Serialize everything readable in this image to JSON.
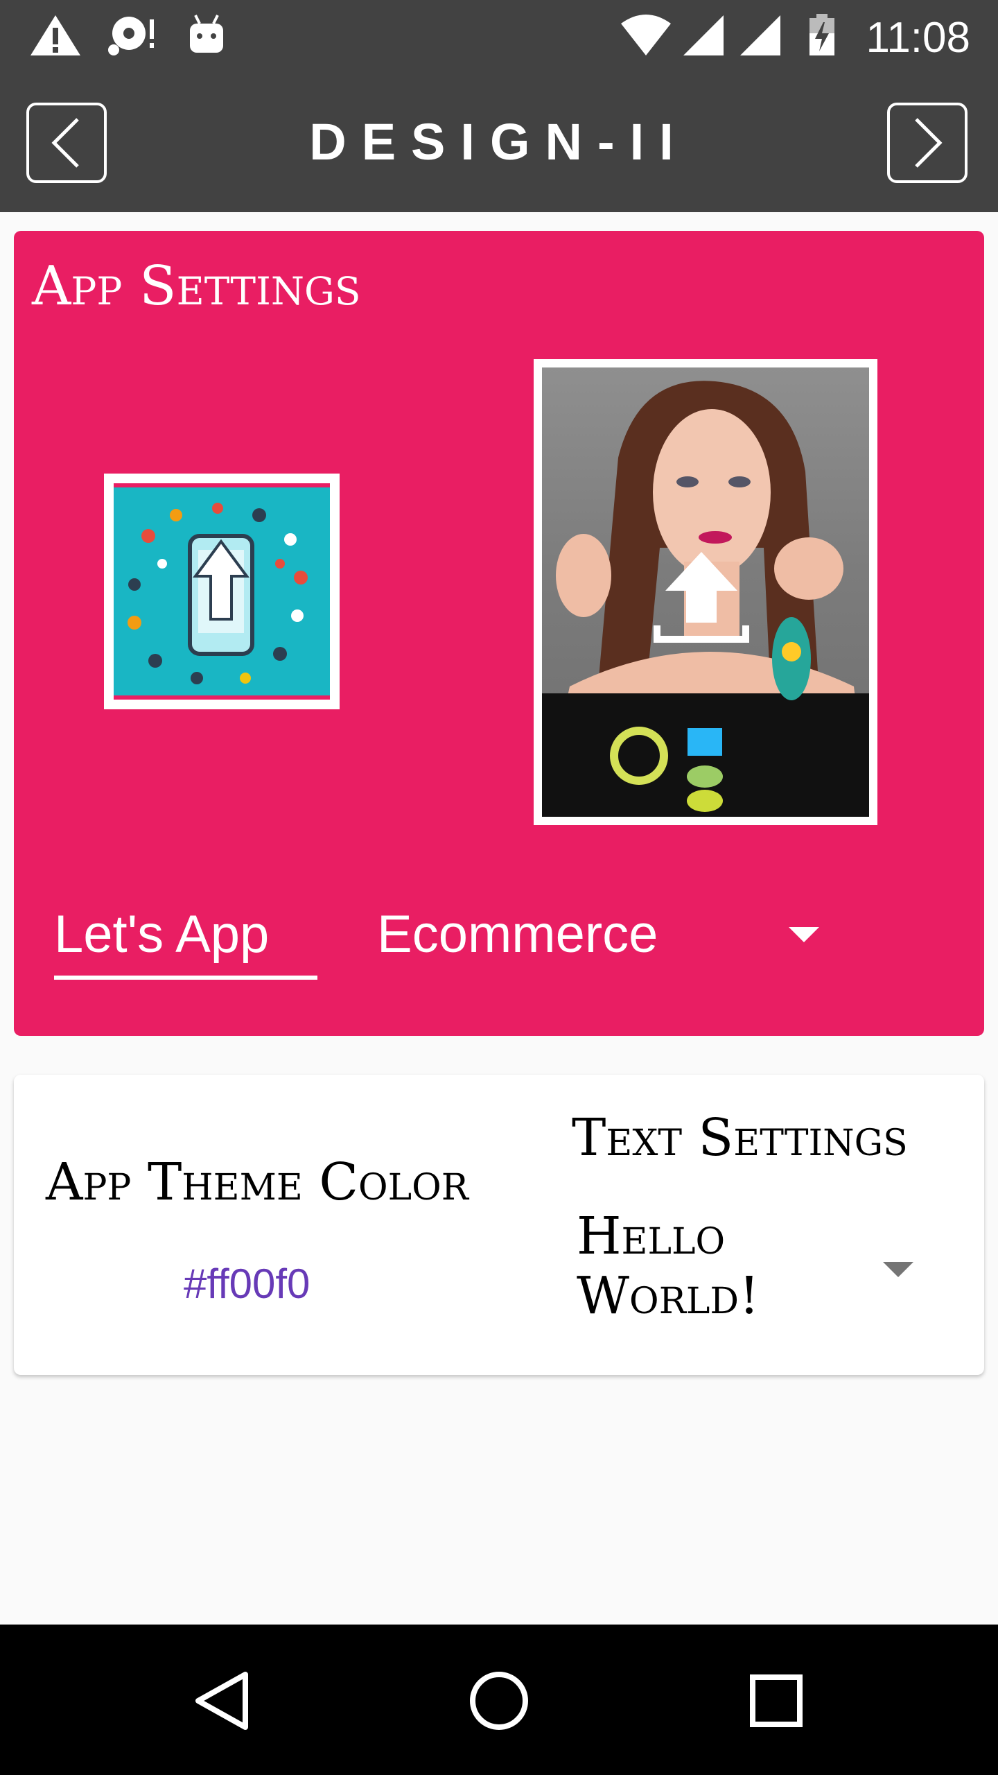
{
  "status_bar": {
    "time": "11:08",
    "icons": [
      "warning-icon",
      "sd-card-alert-icon",
      "android-debug-icon",
      "wifi-icon",
      "signal-icon",
      "signal-icon",
      "battery-charging-icon"
    ]
  },
  "toolbar": {
    "title": "DESIGN-II",
    "back_icon": "chevron-left-icon",
    "forward_icon": "chevron-right-icon"
  },
  "app_settings": {
    "title": "App Settings",
    "logo_image": "app-logo",
    "photo_image": "woman-portrait",
    "upload_icon": "upload-icon",
    "app_name_dropdown": {
      "value": "Let's App"
    },
    "category_dropdown": {
      "value": "Ecommerce"
    }
  },
  "theme": {
    "label": "App Theme Color",
    "value": "#ff00f0"
  },
  "text_settings": {
    "label": "Text Settings",
    "value": "Hello World!"
  },
  "nav_bar": {
    "icons": [
      "back-triangle-icon",
      "home-circle-icon",
      "recents-square-icon"
    ]
  },
  "colors": {
    "primary": "#e91e63",
    "toolbar": "#424242",
    "accent": "#673ab7"
  }
}
